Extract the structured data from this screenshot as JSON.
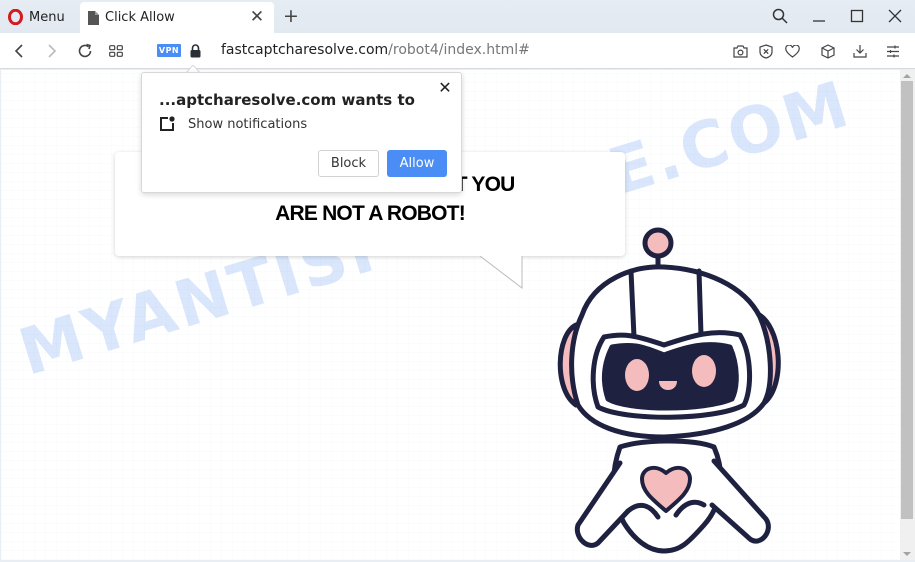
{
  "browser": {
    "menu_label": "Menu",
    "tab": {
      "title": "Click Allow",
      "icon": "document-icon"
    },
    "new_tab_label": "+",
    "window_controls": [
      "search",
      "minimize",
      "maximize",
      "close"
    ],
    "address_bar": {
      "vpn_badge": "VPN",
      "domain": "fastcaptcharesolve.com",
      "path": "/robot4/index.html#"
    },
    "toolbar_icons": [
      "camera-icon",
      "adblock-shield-icon",
      "heart-icon",
      "cube-icon",
      "download-icon",
      "settings-sliders-icon"
    ]
  },
  "notification_popup": {
    "title": "...aptcharesolve.com wants to",
    "permission": "Show notifications",
    "block_label": "Block",
    "allow_label": "Allow",
    "close_label": "✕"
  },
  "page": {
    "message_line1_visible": "I THAT YOU",
    "message_line2": "ARE NOT A ROBOT!",
    "watermark": "MYANTISPYWARE.COM"
  },
  "colors": {
    "accent_blue": "#4a8df4",
    "robot_outline": "#1f2140",
    "robot_pink": "#f4bcbc",
    "opera_red": "#d41b21"
  }
}
